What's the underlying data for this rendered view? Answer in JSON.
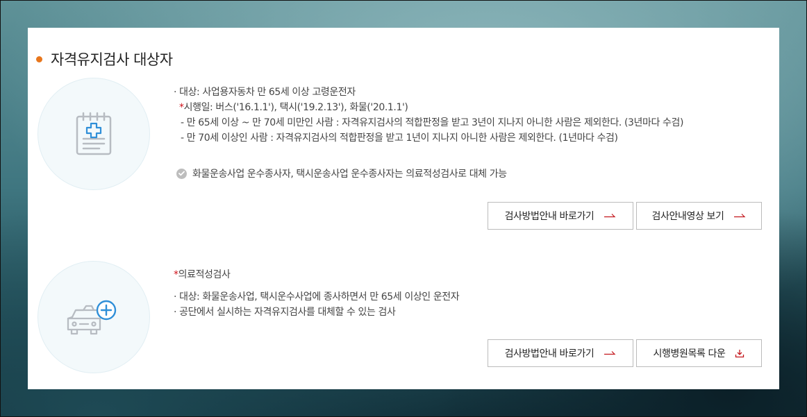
{
  "section": {
    "title": "자격유지검사 대상자"
  },
  "block1": {
    "target": "· 대상: 사업용자동차 만 65세 이상 고령운전자",
    "effective_mark": "*",
    "effective": "시행일: 버스('16.1.1'), 택시('19.2.13'), 화물('20.1.1')",
    "rule1": "- 만 65세 이상 ~ 만 70세 미만인 사람 : 자격유지검사의 적합판정을 받고 3년이 지나지 아니한 사람은 제외한다. (3년마다 수검)",
    "rule2": "- 만 70세 이상인 사람 : 자격유지검사의 적합판정을 받고 1년이 지나지 아니한 사람은 제외한다. (1년마다 수검)",
    "note": "화물운송사업 운수종사자, 택시운송사업 운수종사자는 의료적성검사로 대체 가능",
    "btn_guide": "검사방법안내 바로가기",
    "btn_video": "검사안내영상 보기"
  },
  "block2": {
    "title_mark": "*",
    "title": "의료적성검사",
    "line1": "· 대상: 화물운송사업, 택시운수사업에 종사하면서 만 65세 이상인 운전자",
    "line2": "· 공단에서 실시하는 자격유지검사를 대체할 수 있는 검사",
    "btn_guide": "검사방법안내 바로가기",
    "btn_download": "시행병원목록 다운"
  },
  "icons": {
    "notepad": "notepad-medical-icon",
    "taxi": "taxi-plus-icon",
    "check": "check-circle-icon",
    "arrow": "arrow-right-icon",
    "download": "download-icon"
  },
  "colors": {
    "accent_dot": "#e8761c",
    "required": "#d0121b",
    "arrow": "#c3161c",
    "icon_blue": "#2f8fd8"
  }
}
